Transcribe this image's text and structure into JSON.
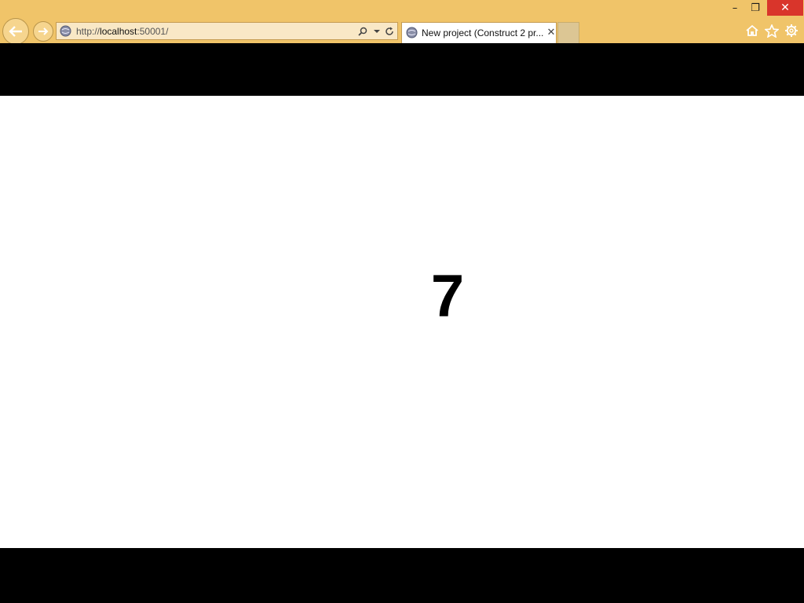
{
  "window": {
    "minimize_glyph": "–",
    "maximize_glyph": "❐",
    "close_glyph": "✕"
  },
  "address_bar": {
    "url_prefix": "http://",
    "url_host": "localhost",
    "url_suffix": ":50001/"
  },
  "tab": {
    "title": "New project (Construct 2 pr...",
    "close_glyph": "✕"
  },
  "icons": {
    "back": "back-arrow-icon",
    "forward": "forward-arrow-icon",
    "site": "page-favicon-icon",
    "search": "search-icon",
    "dropdown": "chevron-down-icon",
    "refresh": "refresh-icon",
    "home": "home-icon",
    "favorites": "star-icon",
    "settings": "gear-icon"
  },
  "colors": {
    "chrome_background": "#f0c469",
    "close_button": "#d9352b",
    "letterbox": "#000000",
    "canvas": "#ffffff"
  },
  "game": {
    "counter": "7"
  }
}
